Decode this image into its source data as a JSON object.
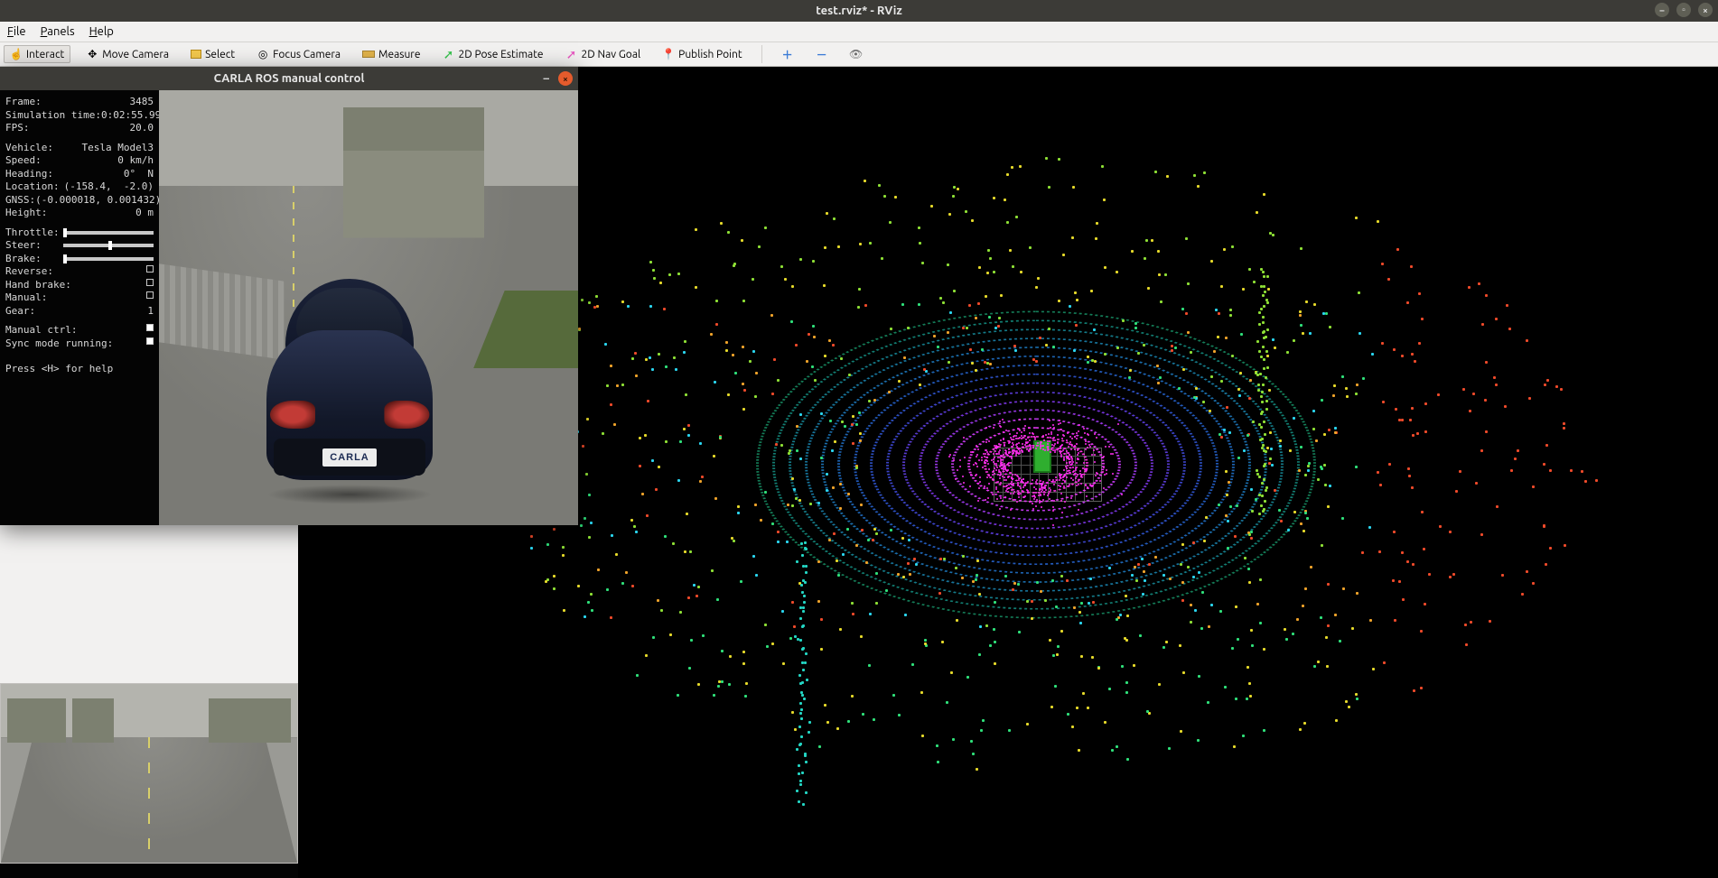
{
  "window": {
    "title": "test.rviz* - RViz"
  },
  "menu": {
    "file": "File",
    "panels": "Panels",
    "help": "Help"
  },
  "toolbar": {
    "interact": "Interact",
    "move_camera": "Move Camera",
    "select": "Select",
    "focus_camera": "Focus Camera",
    "measure": "Measure",
    "pose_estimate": "2D Pose Estimate",
    "nav_goal": "2D Nav Goal",
    "publish_point": "Publish Point"
  },
  "carla": {
    "title": "CARLA ROS manual control",
    "frame_label": "Frame:",
    "frame": "3485",
    "sim_time_label": "Simulation time:",
    "sim_time": "0:02:55.99",
    "fps_label": "FPS:",
    "fps": "20.0",
    "vehicle_label": "Vehicle:",
    "vehicle": "Tesla Model3",
    "speed_label": "Speed:",
    "speed": "0 km/h",
    "heading_label": "Heading:",
    "heading": "0°  N",
    "location_label": "Location:",
    "location": "(-158.4,  -2.0)",
    "gnss_label": "GNSS:",
    "gnss": "(-0.000018, 0.001432)",
    "height_label": "Height:",
    "height": "0 m",
    "throttle_label": "Throttle:",
    "steer_label": "Steer:",
    "brake_label": "Brake:",
    "reverse_label": "Reverse:",
    "handbrake_label": "Hand brake:",
    "manual_label": "Manual:",
    "gear_label": "Gear:",
    "gear": "1",
    "manual_ctrl_label": "Manual ctrl:",
    "sync_label": "Sync mode running:",
    "help": "Press <H> for help",
    "plate": "CARLA",
    "steer_value": 0.5,
    "throttle_value": 0.0,
    "brake_value": 0.0
  }
}
